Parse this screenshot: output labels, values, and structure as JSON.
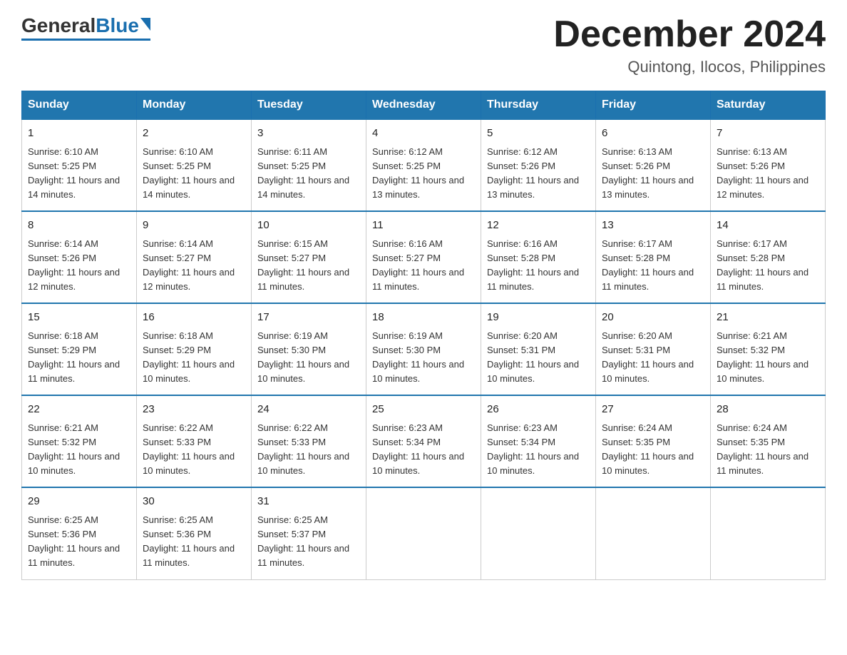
{
  "logo": {
    "general": "General",
    "blue": "Blue"
  },
  "header": {
    "month": "December 2024",
    "location": "Quintong, Ilocos, Philippines"
  },
  "days_of_week": [
    "Sunday",
    "Monday",
    "Tuesday",
    "Wednesday",
    "Thursday",
    "Friday",
    "Saturday"
  ],
  "weeks": [
    [
      {
        "day": "1",
        "sunrise": "6:10 AM",
        "sunset": "5:25 PM",
        "daylight": "11 hours and 14 minutes."
      },
      {
        "day": "2",
        "sunrise": "6:10 AM",
        "sunset": "5:25 PM",
        "daylight": "11 hours and 14 minutes."
      },
      {
        "day": "3",
        "sunrise": "6:11 AM",
        "sunset": "5:25 PM",
        "daylight": "11 hours and 14 minutes."
      },
      {
        "day": "4",
        "sunrise": "6:12 AM",
        "sunset": "5:25 PM",
        "daylight": "11 hours and 13 minutes."
      },
      {
        "day": "5",
        "sunrise": "6:12 AM",
        "sunset": "5:26 PM",
        "daylight": "11 hours and 13 minutes."
      },
      {
        "day": "6",
        "sunrise": "6:13 AM",
        "sunset": "5:26 PM",
        "daylight": "11 hours and 13 minutes."
      },
      {
        "day": "7",
        "sunrise": "6:13 AM",
        "sunset": "5:26 PM",
        "daylight": "11 hours and 12 minutes."
      }
    ],
    [
      {
        "day": "8",
        "sunrise": "6:14 AM",
        "sunset": "5:26 PM",
        "daylight": "11 hours and 12 minutes."
      },
      {
        "day": "9",
        "sunrise": "6:14 AM",
        "sunset": "5:27 PM",
        "daylight": "11 hours and 12 minutes."
      },
      {
        "day": "10",
        "sunrise": "6:15 AM",
        "sunset": "5:27 PM",
        "daylight": "11 hours and 11 minutes."
      },
      {
        "day": "11",
        "sunrise": "6:16 AM",
        "sunset": "5:27 PM",
        "daylight": "11 hours and 11 minutes."
      },
      {
        "day": "12",
        "sunrise": "6:16 AM",
        "sunset": "5:28 PM",
        "daylight": "11 hours and 11 minutes."
      },
      {
        "day": "13",
        "sunrise": "6:17 AM",
        "sunset": "5:28 PM",
        "daylight": "11 hours and 11 minutes."
      },
      {
        "day": "14",
        "sunrise": "6:17 AM",
        "sunset": "5:28 PM",
        "daylight": "11 hours and 11 minutes."
      }
    ],
    [
      {
        "day": "15",
        "sunrise": "6:18 AM",
        "sunset": "5:29 PM",
        "daylight": "11 hours and 11 minutes."
      },
      {
        "day": "16",
        "sunrise": "6:18 AM",
        "sunset": "5:29 PM",
        "daylight": "11 hours and 10 minutes."
      },
      {
        "day": "17",
        "sunrise": "6:19 AM",
        "sunset": "5:30 PM",
        "daylight": "11 hours and 10 minutes."
      },
      {
        "day": "18",
        "sunrise": "6:19 AM",
        "sunset": "5:30 PM",
        "daylight": "11 hours and 10 minutes."
      },
      {
        "day": "19",
        "sunrise": "6:20 AM",
        "sunset": "5:31 PM",
        "daylight": "11 hours and 10 minutes."
      },
      {
        "day": "20",
        "sunrise": "6:20 AM",
        "sunset": "5:31 PM",
        "daylight": "11 hours and 10 minutes."
      },
      {
        "day": "21",
        "sunrise": "6:21 AM",
        "sunset": "5:32 PM",
        "daylight": "11 hours and 10 minutes."
      }
    ],
    [
      {
        "day": "22",
        "sunrise": "6:21 AM",
        "sunset": "5:32 PM",
        "daylight": "11 hours and 10 minutes."
      },
      {
        "day": "23",
        "sunrise": "6:22 AM",
        "sunset": "5:33 PM",
        "daylight": "11 hours and 10 minutes."
      },
      {
        "day": "24",
        "sunrise": "6:22 AM",
        "sunset": "5:33 PM",
        "daylight": "11 hours and 10 minutes."
      },
      {
        "day": "25",
        "sunrise": "6:23 AM",
        "sunset": "5:34 PM",
        "daylight": "11 hours and 10 minutes."
      },
      {
        "day": "26",
        "sunrise": "6:23 AM",
        "sunset": "5:34 PM",
        "daylight": "11 hours and 10 minutes."
      },
      {
        "day": "27",
        "sunrise": "6:24 AM",
        "sunset": "5:35 PM",
        "daylight": "11 hours and 10 minutes."
      },
      {
        "day": "28",
        "sunrise": "6:24 AM",
        "sunset": "5:35 PM",
        "daylight": "11 hours and 11 minutes."
      }
    ],
    [
      {
        "day": "29",
        "sunrise": "6:25 AM",
        "sunset": "5:36 PM",
        "daylight": "11 hours and 11 minutes."
      },
      {
        "day": "30",
        "sunrise": "6:25 AM",
        "sunset": "5:36 PM",
        "daylight": "11 hours and 11 minutes."
      },
      {
        "day": "31",
        "sunrise": "6:25 AM",
        "sunset": "5:37 PM",
        "daylight": "11 hours and 11 minutes."
      },
      null,
      null,
      null,
      null
    ]
  ]
}
